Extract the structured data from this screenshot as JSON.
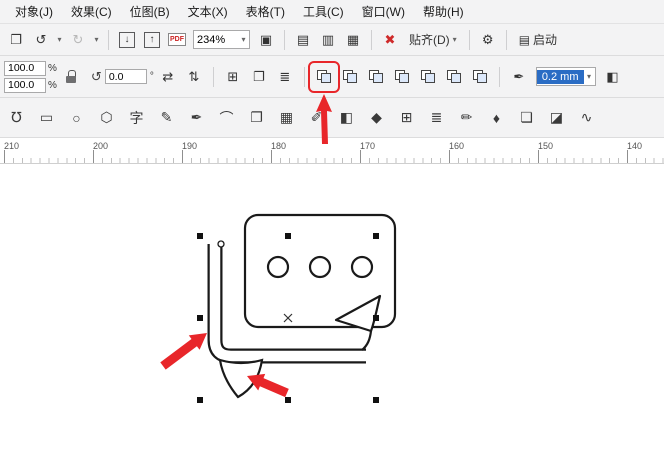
{
  "menu": {
    "items": [
      {
        "name": "menu-item-object",
        "label": "对象(J)"
      },
      {
        "name": "menu-item-effects",
        "label": "效果(C)"
      },
      {
        "name": "menu-item-bitmaps",
        "label": "位图(B)"
      },
      {
        "name": "menu-item-text",
        "label": "文本(X)"
      },
      {
        "name": "menu-item-table",
        "label": "表格(T)"
      },
      {
        "name": "menu-item-tools",
        "label": "工具(C)"
      },
      {
        "name": "menu-item-window",
        "label": "窗口(W)"
      },
      {
        "name": "menu-item-help",
        "label": "帮助(H)"
      }
    ]
  },
  "standard_toolbar": {
    "zoom_level": "234%",
    "snap_label": "贴齐(D)",
    "launch_label": "启动",
    "pdf_label": "PDF"
  },
  "property_bar": {
    "scale_x_value": "100.0",
    "scale_y_value": "100.0",
    "percent_sign": "%",
    "rotation_value": "0.0",
    "degree_sign": "°",
    "outline_width_value": "0.2 mm"
  },
  "icons": {
    "clipboard": "❐",
    "undo": "↺",
    "redo": "↻",
    "dropdown": "▾",
    "import_arrow": "↓",
    "export_arrow": "↑",
    "fullscreen": "▣",
    "view_page": "▤",
    "view_lines": "▥",
    "view_grid": "▦",
    "delete_x": "✖",
    "gear": "⚙",
    "launcher": "▤",
    "rotate": "↺",
    "mirror_h": "⇄",
    "mirror_v": "⇅",
    "arrange": "⊞",
    "pages": "❐",
    "align": "≣",
    "pen_nib": "✒",
    "extra": "◧"
  },
  "toolbox": {
    "items": [
      {
        "name": "shape-tool",
        "glyph": "℧"
      },
      {
        "name": "rectangle-tool",
        "glyph": "▭"
      },
      {
        "name": "ellipse-tool",
        "glyph": "○"
      },
      {
        "name": "polygon-tool",
        "glyph": "⬡"
      },
      {
        "name": "text-tool",
        "glyph": "字"
      },
      {
        "name": "freehand-tool",
        "glyph": "✎"
      },
      {
        "name": "pen-tool",
        "glyph": "✒"
      },
      {
        "name": "bspline-tool",
        "glyph": "⌒"
      },
      {
        "name": "object-stack-tool",
        "glyph": "❐"
      },
      {
        "name": "transparency-tool",
        "glyph": "▦"
      },
      {
        "name": "eyedropper-tool",
        "glyph": "✐"
      },
      {
        "name": "smart-fill-tool",
        "glyph": "◧"
      },
      {
        "name": "fill-tool",
        "glyph": "◆"
      },
      {
        "name": "graph-paper-tool",
        "glyph": "⊞"
      },
      {
        "name": "mesh-fill-tool",
        "glyph": "≣"
      },
      {
        "name": "brush-tool",
        "glyph": "✏"
      },
      {
        "name": "outline-pen-tool",
        "glyph": "♦"
      },
      {
        "name": "shadow-tool",
        "glyph": "❏"
      },
      {
        "name": "eraser-tool",
        "glyph": "◪"
      },
      {
        "name": "connector-tool",
        "glyph": "∿"
      }
    ]
  },
  "ruler": {
    "labels": [
      "210",
      "200",
      "190",
      "180",
      "170",
      "160",
      "150",
      "140"
    ]
  },
  "colors": {
    "accent_red": "#e8262a",
    "selection_bg": "#2a6cc4",
    "stroke": "#1a1a1a"
  }
}
